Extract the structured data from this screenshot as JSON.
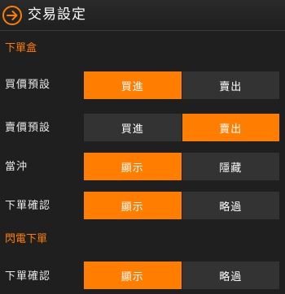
{
  "header": {
    "title": "交易設定"
  },
  "sections": [
    {
      "title": "下單盒",
      "rows": [
        {
          "label": "買價預設",
          "options": [
            "買進",
            "賣出"
          ],
          "selected": 0
        },
        {
          "label": "賣價預設",
          "options": [
            "買進",
            "賣出"
          ],
          "selected": 1
        },
        {
          "label": "當沖",
          "options": [
            "顯示",
            "隱藏"
          ],
          "selected": 0
        },
        {
          "label": "下單確認",
          "options": [
            "顯示",
            "略過"
          ],
          "selected": 0
        }
      ]
    },
    {
      "title": "閃電下單",
      "rows": [
        {
          "label": "下單確認",
          "options": [
            "顯示",
            "略過"
          ],
          "selected": 0
        }
      ]
    }
  ],
  "colors": {
    "accent": "#ff7d00",
    "inactive": "#333333",
    "background": "#1f1f1f"
  },
  "icons": {
    "back": "circle-arrow-right-icon"
  }
}
